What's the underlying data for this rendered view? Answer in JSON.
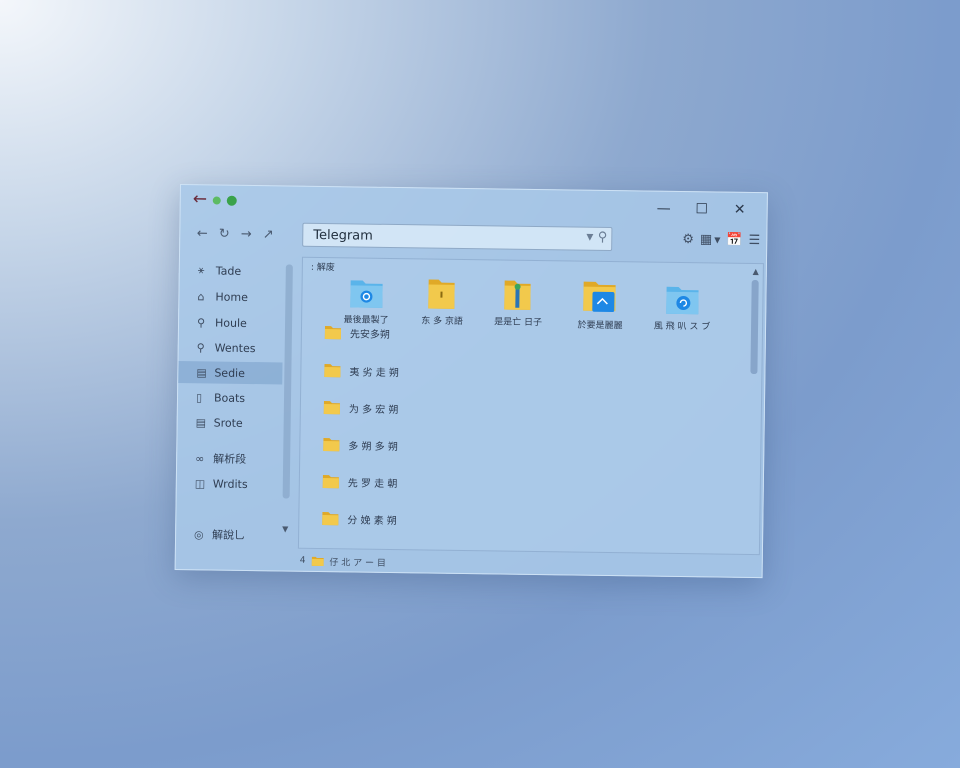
{
  "window": {
    "controls": {
      "minimize": "—",
      "maximize": "☐",
      "close": "✕"
    }
  },
  "navigation": {
    "address": "Telegram",
    "search_icon": "search-icon"
  },
  "sidebar": {
    "items": [
      {
        "label": "Tade",
        "icon": "quick-access-icon"
      },
      {
        "label": "Home",
        "icon": "home-icon"
      },
      {
        "label": "Houle",
        "icon": "pin-icon"
      },
      {
        "label": "Wentes",
        "icon": "search-icon"
      },
      {
        "label": "Sedie",
        "icon": "documents-icon",
        "active": true
      },
      {
        "label": "Boats",
        "icon": "phone-icon"
      },
      {
        "label": "Srote",
        "icon": "drive-icon"
      },
      {
        "label": "解析段",
        "icon": "link-icon"
      },
      {
        "label": "Wrdits",
        "icon": "file-icon"
      },
      {
        "label": "解說乚",
        "icon": "network-icon"
      }
    ]
  },
  "content": {
    "group_label": ": 解废",
    "grid_items": [
      {
        "label": "最後最製了",
        "type": "sync-folder"
      },
      {
        "label": "东 多 京語",
        "type": "folder"
      },
      {
        "label": "是是亡 日子",
        "type": "zip-folder"
      },
      {
        "label": "於要是麗麗",
        "type": "media-folder"
      },
      {
        "label": "風 飛 叭 ス ブ",
        "type": "sync-folder"
      }
    ],
    "list_items": [
      {
        "label": "先安多朔"
      },
      {
        "label": "夷 劣 走 朔"
      },
      {
        "label": "为 多 宏 朔"
      },
      {
        "label": "多 朔 多 朔"
      },
      {
        "label": "先 罗 走 朝"
      },
      {
        "label": "分 娩 素 朔"
      }
    ]
  },
  "status": {
    "count": "4",
    "text": "仔 北 ア ー 目"
  },
  "colors": {
    "folder_yellow": "#f2c94c",
    "folder_blue": "#5ab4ea",
    "accent_blue": "#1e88e5"
  }
}
